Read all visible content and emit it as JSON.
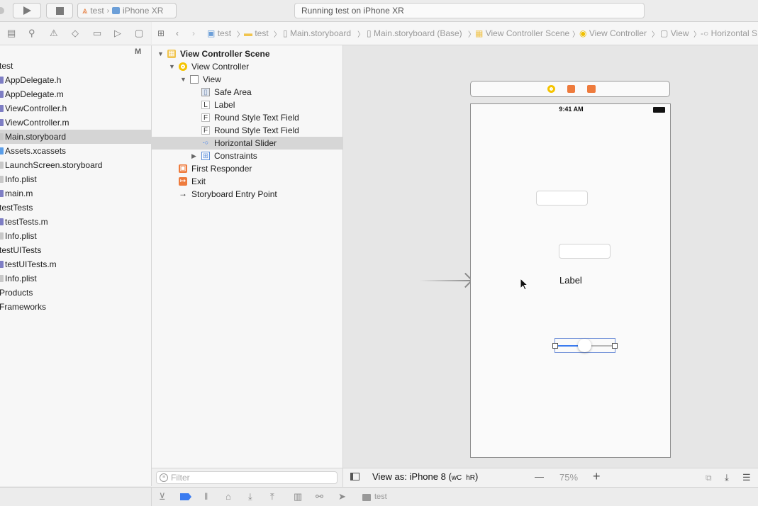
{
  "toolbar": {
    "scheme_project": "test",
    "scheme_device": "iPhone XR",
    "status": "Running test on iPhone XR"
  },
  "navigator": {
    "badge": "M",
    "items": [
      {
        "label": "test",
        "indent": 0,
        "kind": "group"
      },
      {
        "label": "AppDelegate.h",
        "indent": 1,
        "kind": "h"
      },
      {
        "label": "AppDelegate.m",
        "indent": 1,
        "kind": "m"
      },
      {
        "label": "ViewController.h",
        "indent": 1,
        "kind": "h"
      },
      {
        "label": "ViewController.m",
        "indent": 1,
        "kind": "m"
      },
      {
        "label": "Main.storyboard",
        "indent": 1,
        "kind": "storyboard",
        "selected": true
      },
      {
        "label": "Assets.xcassets",
        "indent": 1,
        "kind": "assets"
      },
      {
        "label": "LaunchScreen.storyboard",
        "indent": 1,
        "kind": "storyboard"
      },
      {
        "label": "Info.plist",
        "indent": 1,
        "kind": "plist"
      },
      {
        "label": "main.m",
        "indent": 1,
        "kind": "m"
      },
      {
        "label": "testTests",
        "indent": 0,
        "kind": "group"
      },
      {
        "label": "testTests.m",
        "indent": 1,
        "kind": "m"
      },
      {
        "label": "Info.plist",
        "indent": 1,
        "kind": "plist"
      },
      {
        "label": "testUITests",
        "indent": 0,
        "kind": "group"
      },
      {
        "label": "testUITests.m",
        "indent": 1,
        "kind": "m"
      },
      {
        "label": "Info.plist",
        "indent": 1,
        "kind": "plist"
      },
      {
        "label": "Products",
        "indent": 0,
        "kind": "group"
      },
      {
        "label": "Frameworks",
        "indent": 0,
        "kind": "group"
      }
    ]
  },
  "jumpbar": {
    "crumbs": [
      "test",
      "test",
      "Main.storyboard",
      "Main.storyboard (Base)",
      "View Controller Scene",
      "View Controller",
      "View",
      "Horizontal S"
    ]
  },
  "outline": {
    "rows": [
      {
        "label": "View Controller Scene",
        "bold": true,
        "icon": "scene-icon",
        "glyph": "▦"
      },
      {
        "label": "View Controller",
        "icon": "view-controller-icon",
        "glyph": "◉"
      },
      {
        "label": "View",
        "icon": "view-icon",
        "glyph": ""
      },
      {
        "label": "Safe Area",
        "icon": "safe-area-icon",
        "glyph": "▯"
      },
      {
        "label": "Label",
        "icon": "label-icon",
        "glyph": "L"
      },
      {
        "label": "Round Style Text Field",
        "icon": "text-field-icon",
        "glyph": "F"
      },
      {
        "label": "Round Style Text Field",
        "icon": "text-field-icon",
        "glyph": "F"
      },
      {
        "label": "Horizontal Slider",
        "icon": "slider-icon",
        "glyph": "-○",
        "selected": true
      },
      {
        "label": "Constraints",
        "icon": "constraints-icon",
        "glyph": "⊞"
      },
      {
        "label": "First Responder",
        "icon": "first-responder-icon",
        "glyph": "▣"
      },
      {
        "label": "Exit",
        "icon": "exit-icon",
        "glyph": "↦"
      },
      {
        "label": "Storyboard Entry Point",
        "icon": "entry-arrow-icon",
        "glyph": "→"
      }
    ],
    "filter_placeholder": "Filter"
  },
  "canvas": {
    "status_time": "9:41 AM",
    "label_text": "Label",
    "slider_value": 0.5
  },
  "canvasbar": {
    "view_as": "View as: iPhone 8 (",
    "size_w": "wC",
    "size_h": "hR",
    "view_as_close": ")",
    "zoom": "75%",
    "zoom_out": "—",
    "zoom_in": "+"
  },
  "debugbar": {
    "target": "test"
  }
}
